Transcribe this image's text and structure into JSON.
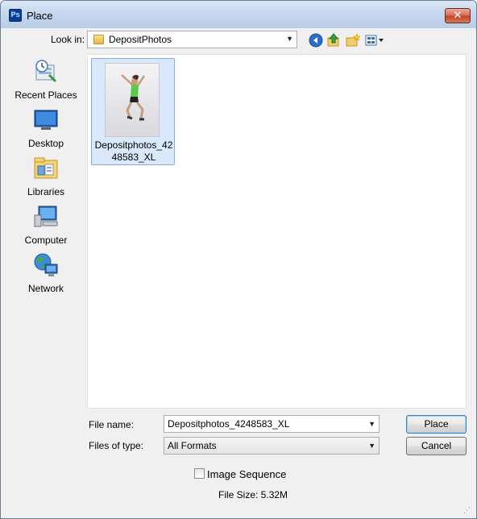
{
  "window": {
    "title": "Place",
    "app_icon_text": "Ps",
    "close_glyph": "✕"
  },
  "look_in": {
    "label": "Look in:",
    "value": "DepositPhotos"
  },
  "toolbar": {
    "icons": [
      "back-icon",
      "up-folder-icon",
      "new-folder-icon",
      "view-menu-icon"
    ]
  },
  "places": [
    {
      "label": "Recent Places",
      "icon": "recent-places-icon"
    },
    {
      "label": "Desktop",
      "icon": "desktop-icon"
    },
    {
      "label": "Libraries",
      "icon": "libraries-icon"
    },
    {
      "label": "Computer",
      "icon": "computer-icon"
    },
    {
      "label": "Network",
      "icon": "network-icon"
    }
  ],
  "files": [
    {
      "name": "Depositphotos_4248583_XL",
      "selected": true
    }
  ],
  "file_name": {
    "label": "File name:",
    "value": "Depositphotos_4248583_XL"
  },
  "file_type": {
    "label": "Files of type:",
    "value": "All Formats"
  },
  "buttons": {
    "place": "Place",
    "cancel": "Cancel"
  },
  "image_sequence": {
    "label": "Image Sequence",
    "checked": false
  },
  "file_size": "File Size: 5.32M",
  "colors": {
    "titlebar": "#c5d7ee",
    "selection": "#d9e8fb",
    "close": "#c24527"
  }
}
